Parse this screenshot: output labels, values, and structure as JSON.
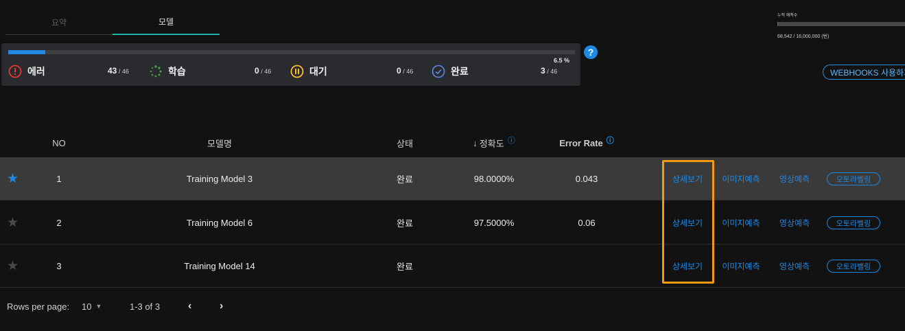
{
  "tabs": [
    {
      "label": "요약"
    },
    {
      "label": "모델"
    }
  ],
  "status": {
    "progress_percent": 6.5,
    "percent_label": "6.5 %",
    "items": [
      {
        "label": "에러",
        "count": "43",
        "total": " / 46"
      },
      {
        "label": "학습",
        "count": "0",
        "total": " / 46"
      },
      {
        "label": "대기",
        "count": "0",
        "total": " / 46"
      },
      {
        "label": "완료",
        "count": "3",
        "total": " / 46"
      }
    ],
    "help_label": "?"
  },
  "usage": {
    "title": "누적 예측수",
    "value_label": "68,542 / 16,000,000 (번)",
    "used": 68542,
    "limit": 16000000
  },
  "webhooks_label": "WEBHOOKS 사용하기",
  "table": {
    "headers": {
      "no": "NO",
      "name": "모델명",
      "status": "상태",
      "accuracy_arrow": "↓",
      "accuracy": "정확도",
      "error_rate": "Error Rate",
      "info_icon": "?"
    },
    "rows": [
      {
        "no": "1",
        "name": "Training Model 3",
        "status": "완료",
        "accuracy": "98.0000%",
        "error_rate": "0.043",
        "favorite": true
      },
      {
        "no": "2",
        "name": "Training Model 6",
        "status": "완료",
        "accuracy": "97.5000%",
        "error_rate": "0.06",
        "favorite": false
      },
      {
        "no": "3",
        "name": "Training Model 14",
        "status": "완료",
        "accuracy": "",
        "error_rate": "",
        "favorite": false
      }
    ],
    "actions": {
      "detail": "상세보기",
      "image_predict": "이미지예측",
      "video_predict": "영상예측",
      "auto_label": "오토라벨링"
    },
    "star_glyph": "★"
  },
  "pagination": {
    "rows_per_page_label": "Rows per page:",
    "rows_per_page_value": "10",
    "range_label": "1-3 of 3",
    "prev": "‹",
    "next": "›"
  },
  "colors": {
    "accent": "#1e88e5",
    "tab_indicator": "#1fb2a3",
    "error": "#e53935",
    "training": "#43a047",
    "waiting": "#fbc02d",
    "highlight_box": "#f59a10"
  }
}
